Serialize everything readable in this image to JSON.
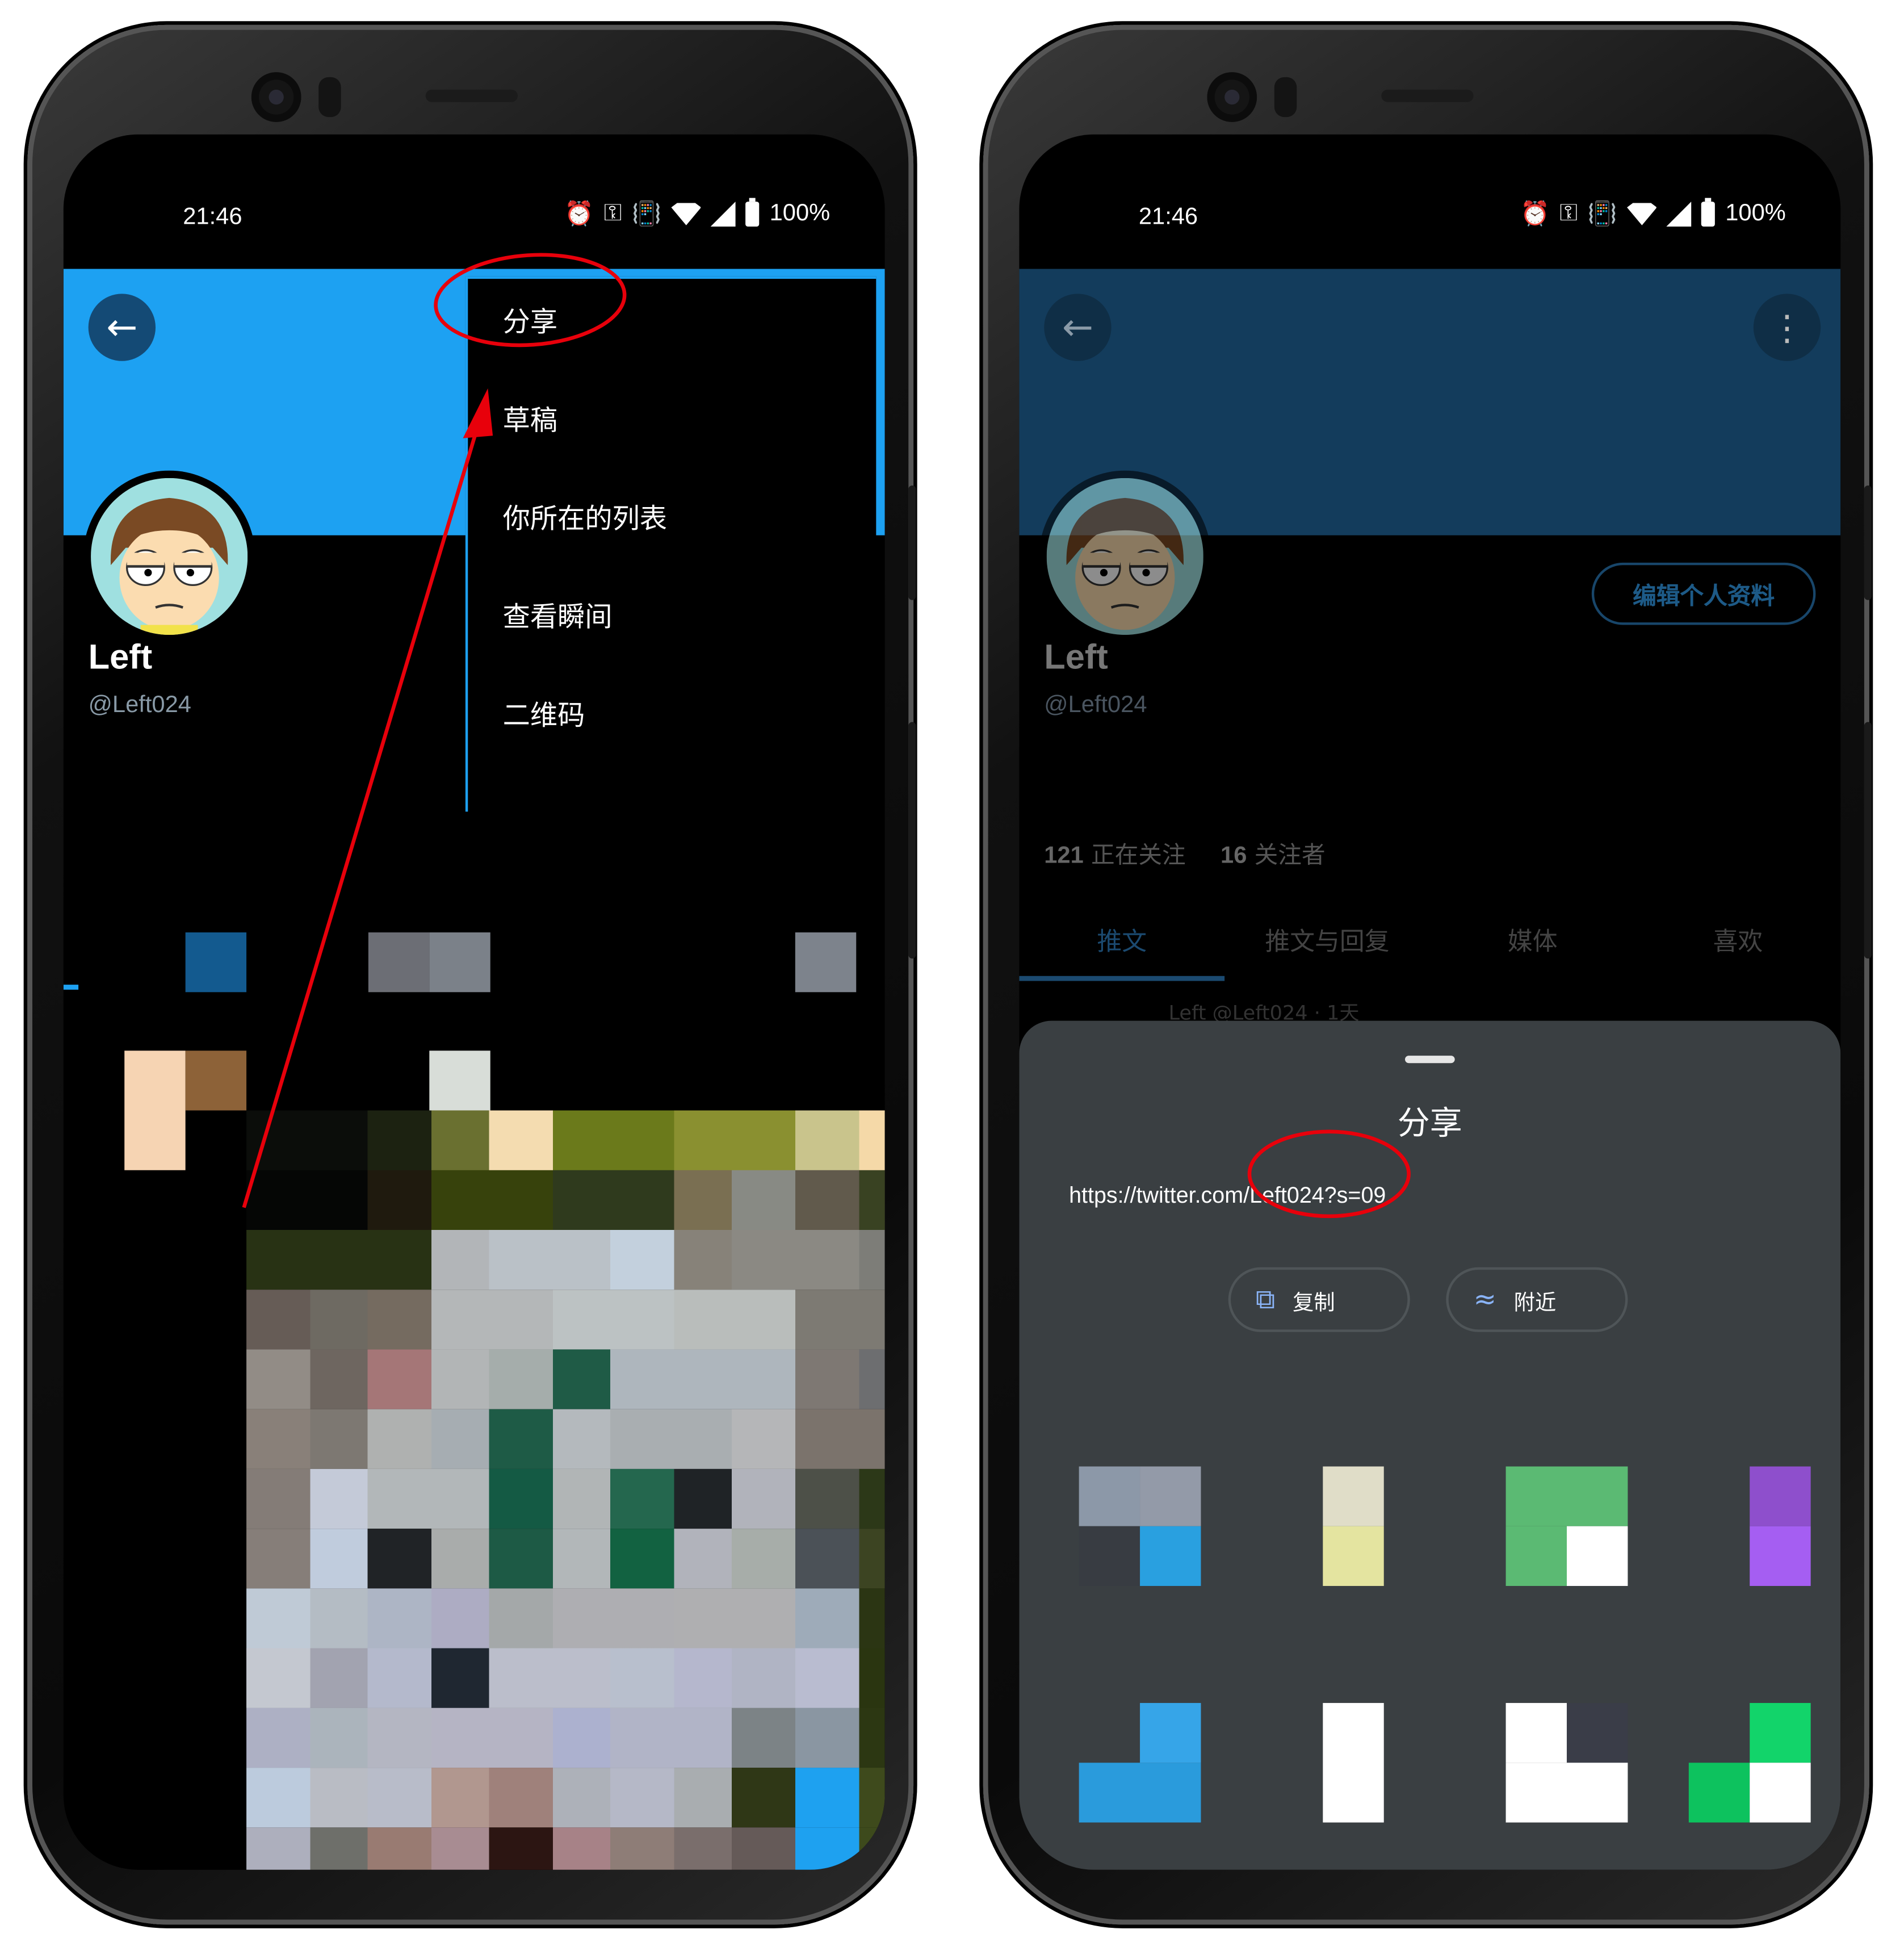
{
  "left_phone": {
    "status": {
      "time": "21:46",
      "battery": "100%"
    },
    "header_color": "#1da1f2",
    "profile": {
      "name": "Left",
      "handle": "@Left024"
    },
    "menu": {
      "items": [
        {
          "label": "分享"
        },
        {
          "label": "草稿"
        },
        {
          "label": "你所在的列表"
        },
        {
          "label": "查看瞬间"
        },
        {
          "label": "二维码"
        }
      ]
    }
  },
  "right_phone": {
    "status": {
      "time": "21:46",
      "battery": "100%"
    },
    "header_color": "#133c5c",
    "profile": {
      "name": "Left",
      "handle": "@Left024",
      "edit_button": "编辑个人资料"
    },
    "counts": {
      "following_num": "121",
      "following_label": "正在关注",
      "followers_num": "16",
      "followers_label": "关注者"
    },
    "tabs": [
      {
        "label": "推文"
      },
      {
        "label": "推文与回复"
      },
      {
        "label": "媒体"
      },
      {
        "label": "喜欢"
      }
    ],
    "tweet_peek": "Left @Left024 · 1天",
    "share_sheet": {
      "title": "分享",
      "url": "https://twitter.com/Left024?s=09",
      "copy_label": "复制",
      "nearby_label": "附近"
    }
  },
  "icons": {
    "back": "arrow-left-icon",
    "more": "more-vertical-icon",
    "alarm": "alarm-icon",
    "vpn": "key-icon",
    "vibrate": "vibrate-icon",
    "wifi": "wifi-icon",
    "signal": "signal-icon",
    "battery": "battery-icon",
    "copy": "copy-icon",
    "nearby": "nearby-icon"
  },
  "annotation_color": "#e8000b"
}
